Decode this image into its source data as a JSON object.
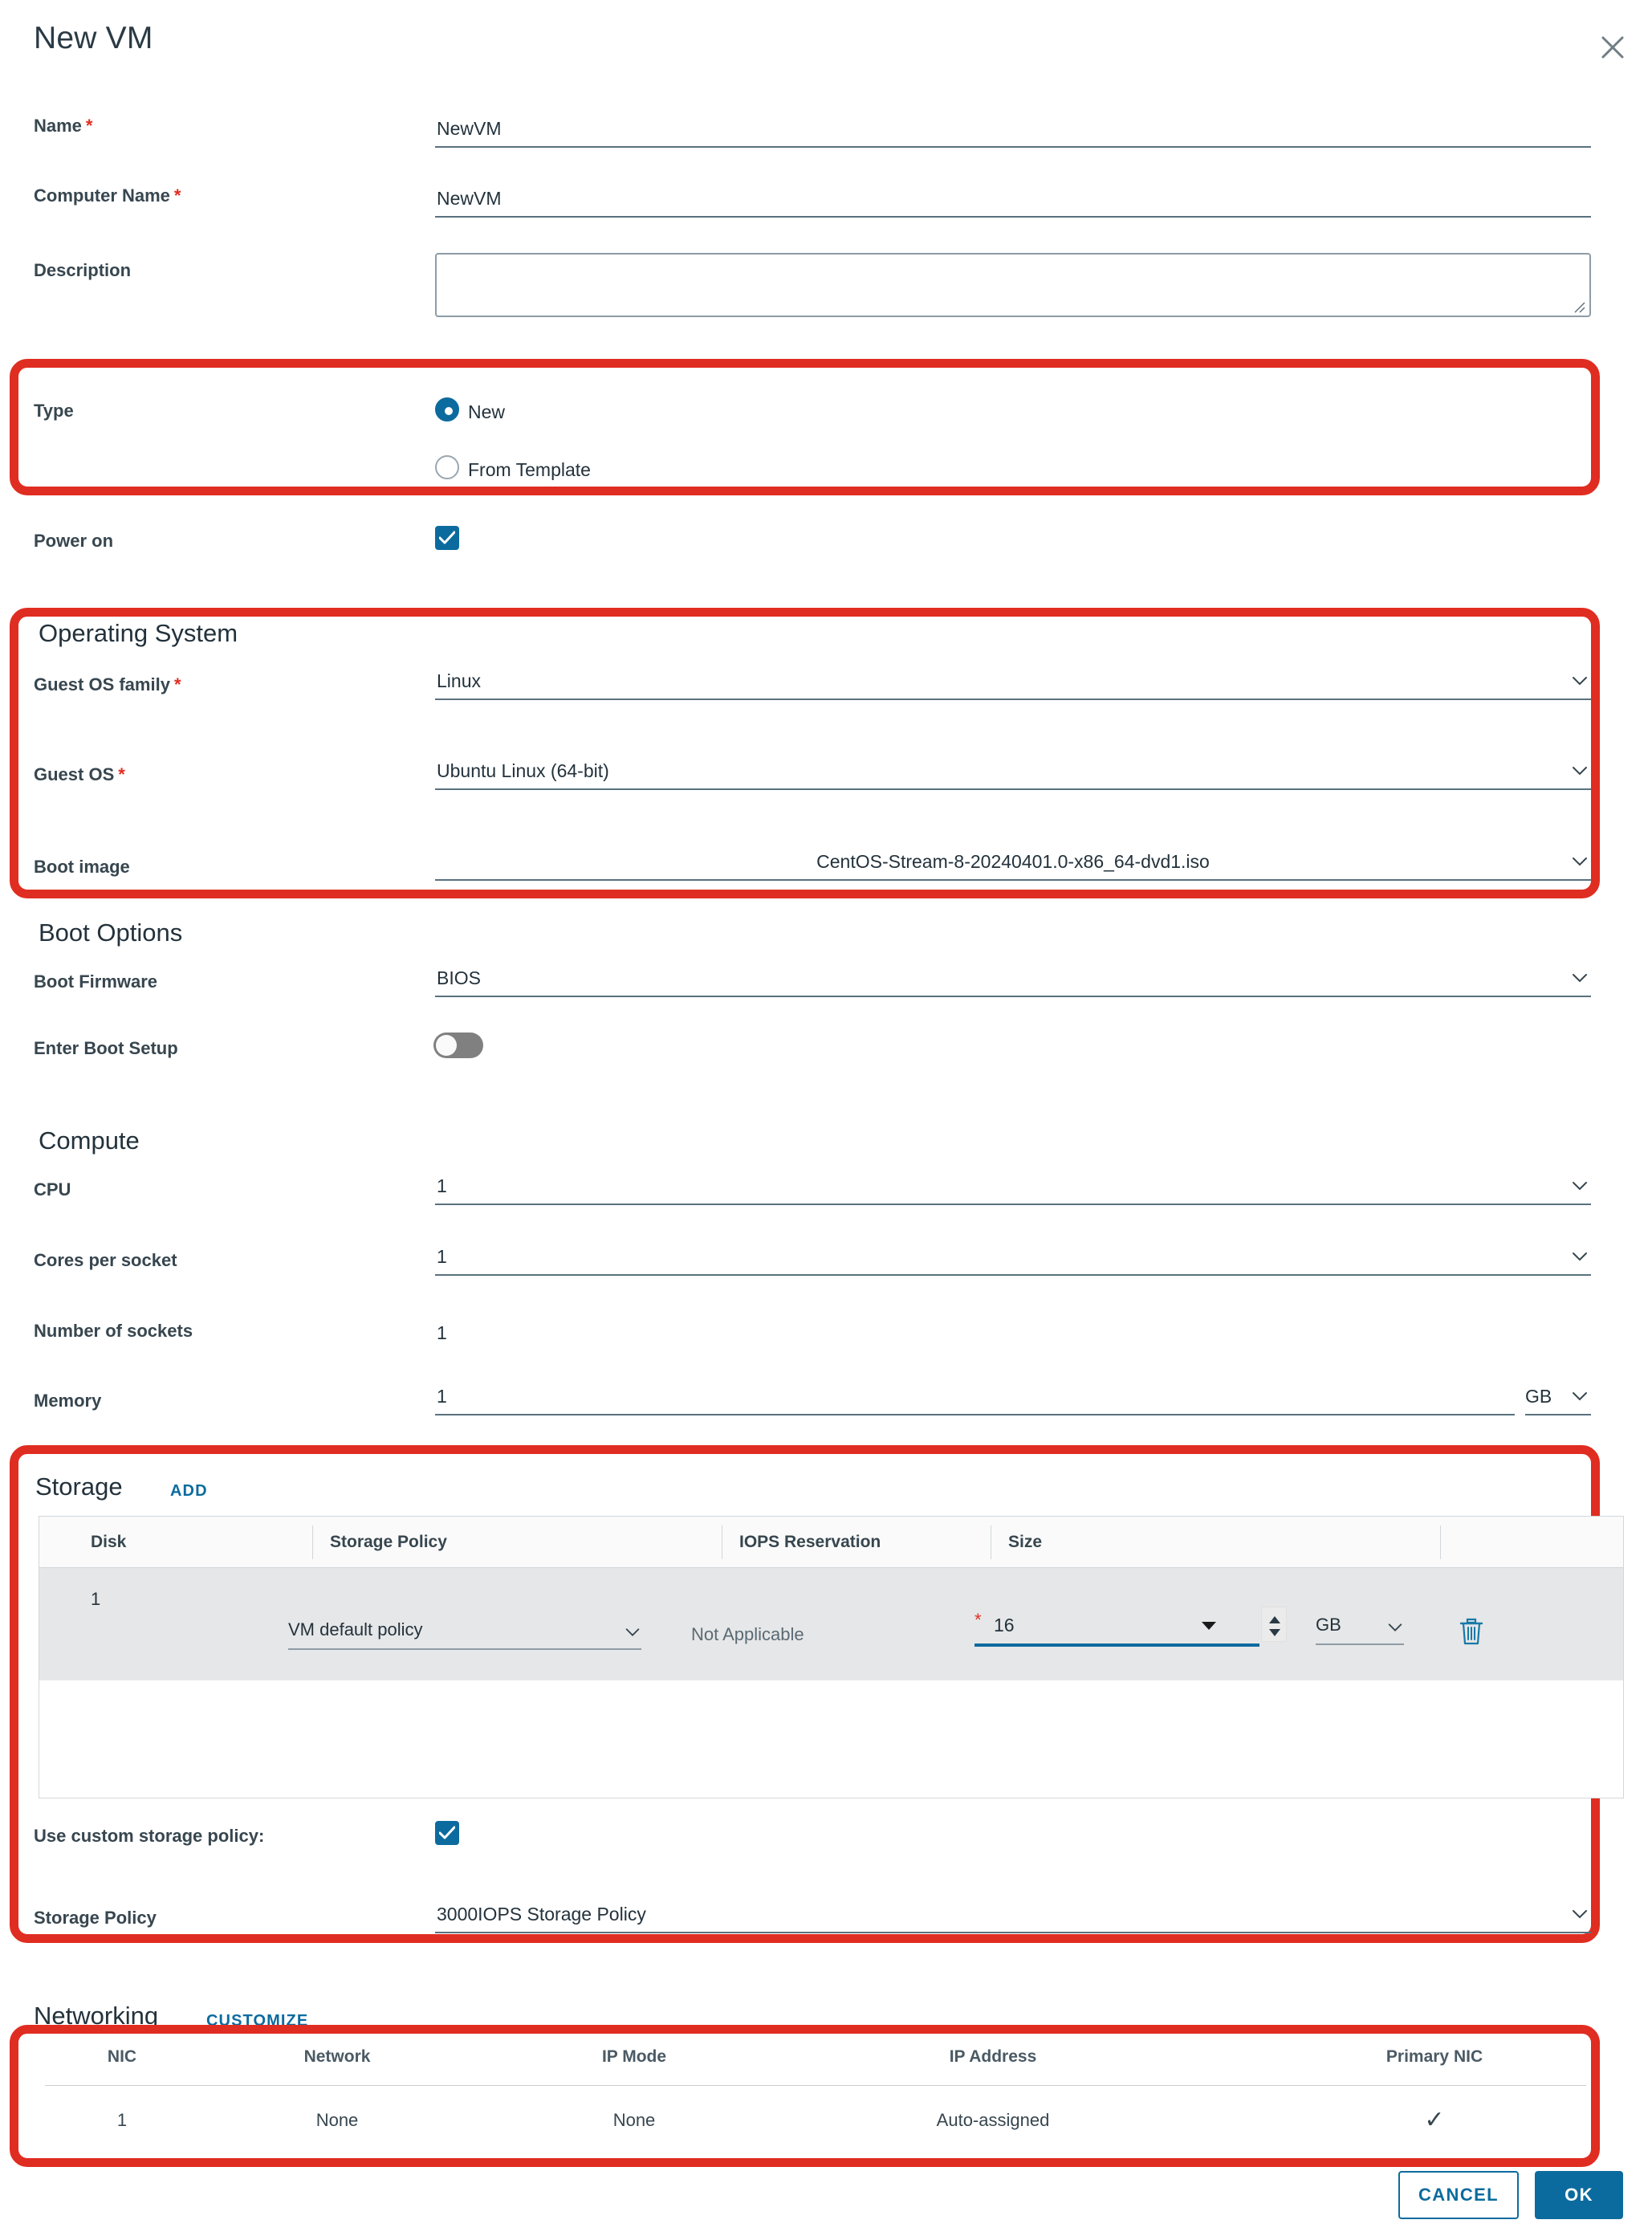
{
  "dialog": {
    "title": "New VM",
    "close_icon": "close-icon"
  },
  "basic": {
    "name": {
      "label": "Name",
      "required": "*",
      "value": "NewVM"
    },
    "computer_name": {
      "label": "Computer Name",
      "required": "*",
      "value": "NewVM"
    },
    "description": {
      "label": "Description",
      "value": "",
      "placeholder": ""
    }
  },
  "type": {
    "label": "Type",
    "options": [
      {
        "label": "New",
        "selected": true
      },
      {
        "label": "From Template",
        "selected": false
      }
    ]
  },
  "power_on": {
    "label": "Power on",
    "checked": true
  },
  "operating_system": {
    "heading": "Operating System",
    "guest_os_family": {
      "label": "Guest OS family",
      "required": "*",
      "value": "Linux"
    },
    "guest_os": {
      "label": "Guest OS",
      "required": "*",
      "value": "Ubuntu Linux (64-bit)"
    },
    "boot_image": {
      "label": "Boot image",
      "value": "CentOS-Stream-8-20240401.0-x86_64-dvd1.iso"
    }
  },
  "boot_options": {
    "heading": "Boot Options",
    "boot_firmware": {
      "label": "Boot Firmware",
      "value": "BIOS"
    },
    "enter_boot_setup": {
      "label": "Enter Boot Setup",
      "on": false
    }
  },
  "compute": {
    "heading": "Compute",
    "cpu": {
      "label": "CPU",
      "value": "1"
    },
    "cores_per_socket": {
      "label": "Cores per socket",
      "value": "1"
    },
    "number_of_sockets": {
      "label": "Number of sockets",
      "value": "1"
    },
    "memory": {
      "label": "Memory",
      "value": "1",
      "unit": "GB"
    }
  },
  "storage": {
    "heading": "Storage",
    "add_label": "ADD",
    "columns": [
      "Disk",
      "Storage Policy",
      "IOPS Reservation",
      "Size",
      ""
    ],
    "row": {
      "disk": "1",
      "storage_policy": "VM default policy",
      "iops_reservation": "Not Applicable",
      "size_required": "*",
      "size": "16",
      "size_unit": "GB",
      "delete_icon": "trash-icon"
    },
    "use_custom_policy": {
      "label": "Use custom storage policy:",
      "checked": true
    },
    "storage_policy": {
      "label": "Storage Policy",
      "value": "3000IOPS Storage Policy"
    }
  },
  "networking": {
    "heading": "Networking",
    "customize_label": "CUSTOMIZE",
    "columns": [
      "NIC",
      "Network",
      "IP Mode",
      "IP Address",
      "Primary NIC"
    ],
    "rows": [
      {
        "nic": "1",
        "network": "None",
        "ip_mode": "None",
        "ip_address": "Auto-assigned",
        "primary": "✓"
      }
    ]
  },
  "footer": {
    "cancel_label": "CANCEL",
    "ok_label": "OK"
  },
  "colors": {
    "accent": "#0c6b9e",
    "annotation": "#e02d21",
    "required": "#e02d21",
    "label": "#37464f"
  }
}
